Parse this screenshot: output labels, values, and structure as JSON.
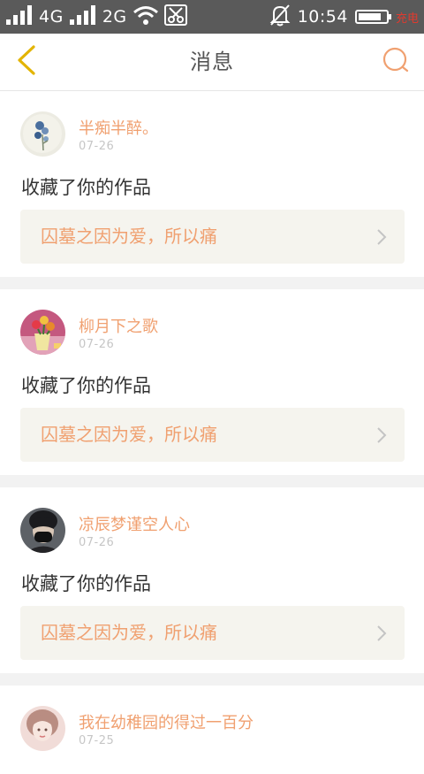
{
  "status_bar": {
    "network_1": "4G",
    "network_2": "2G",
    "time": "10:54",
    "battery_level": 0.85,
    "charging_label": "充电"
  },
  "header": {
    "title": "消息",
    "back_icon": "chevron-left-icon",
    "search_icon": "search-icon"
  },
  "colors": {
    "accent": "#f0a070",
    "back_icon": "#e3b400",
    "status_bar_bg": "#5a5a5a",
    "work_box_bg": "#f5f4ee"
  },
  "messages": [
    {
      "user_name": "半痴半醉。",
      "date": "07-26",
      "action": "收藏了你的作品",
      "work_title": "囚墓之因为爱，所以痛",
      "avatar": "watercolor-flower-avatar"
    },
    {
      "user_name": "柳月下之歌",
      "date": "07-26",
      "action": "收藏了你的作品",
      "work_title": "囚墓之因为爱，所以痛",
      "avatar": "tulip-vase-avatar"
    },
    {
      "user_name": "凉辰梦谨空人心",
      "date": "07-26",
      "action": "收藏了你的作品",
      "work_title": "囚墓之因为爱，所以痛",
      "avatar": "masked-person-avatar"
    },
    {
      "user_name": "我在幼稚园的得过一百分",
      "date": "07-25",
      "avatar": "girl-portrait-avatar"
    }
  ]
}
